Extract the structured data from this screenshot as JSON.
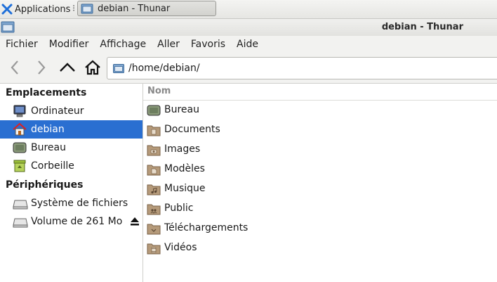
{
  "panel": {
    "apps_label": "Applications",
    "task_label": "debian - Thunar"
  },
  "window": {
    "title": "debian - Thunar"
  },
  "menubar": {
    "items": [
      "Fichier",
      "Modifier",
      "Affichage",
      "Aller",
      "Favoris",
      "Aide"
    ]
  },
  "toolbar": {
    "location": "/home/debian/"
  },
  "sidebar": {
    "places_heading": "Emplacements",
    "places": [
      {
        "label": "Ordinateur",
        "icon": "computer-icon"
      },
      {
        "label": "debian",
        "icon": "home-icon",
        "selected": true
      },
      {
        "label": "Bureau",
        "icon": "desktop-icon"
      },
      {
        "label": "Corbeille",
        "icon": "trash-icon"
      }
    ],
    "devices_heading": "Périphériques",
    "devices": [
      {
        "label": "Système de fichiers",
        "icon": "drive-icon"
      },
      {
        "label": "Volume de 261 Mo",
        "icon": "drive-icon",
        "eject_icon": "eject-icon"
      }
    ]
  },
  "filelist": {
    "column_name": "Nom",
    "files": [
      {
        "name": "Bureau",
        "icon": "desktop-folder-icon"
      },
      {
        "name": "Documents",
        "icon": "documents-folder-icon"
      },
      {
        "name": "Images",
        "icon": "pictures-folder-icon"
      },
      {
        "name": "Modèles",
        "icon": "templates-folder-icon"
      },
      {
        "name": "Musique",
        "icon": "music-folder-icon"
      },
      {
        "name": "Public",
        "icon": "public-folder-icon"
      },
      {
        "name": "Téléchargements",
        "icon": "downloads-folder-icon"
      },
      {
        "name": "Vidéos",
        "icon": "videos-folder-icon"
      }
    ]
  },
  "colors": {
    "selection": "#2a6fd1",
    "folder": "#b59a7a",
    "folder_dark": "#8c7355"
  }
}
